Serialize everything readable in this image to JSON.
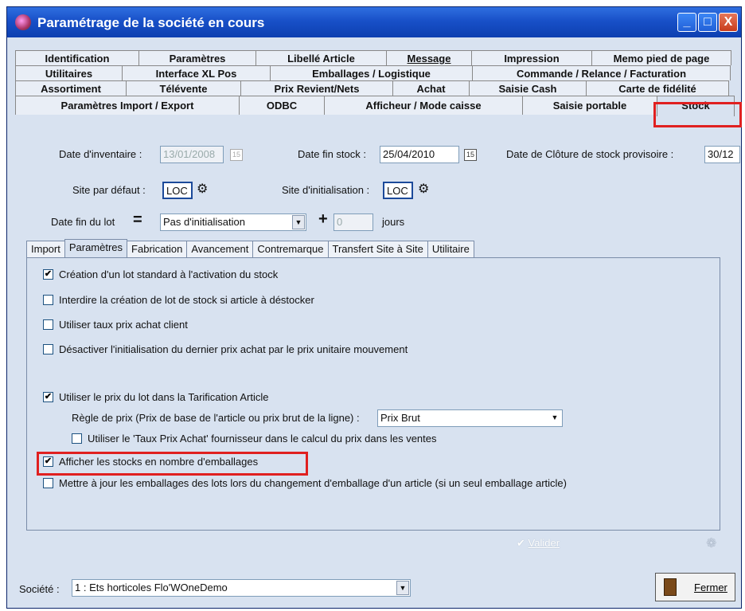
{
  "window": {
    "title": "Paramétrage de la société en cours",
    "controls": {
      "minimize": "_",
      "maximize": "□",
      "close": "X"
    }
  },
  "tabs": {
    "row1": [
      "Identification",
      "Paramètres",
      "Libellé Article",
      "Message",
      "Impression",
      "Memo pied de page"
    ],
    "row2": [
      "Utilitaires",
      "Interface XL Pos",
      "Emballages / Logistique",
      "Commande / Relance / Facturation"
    ],
    "row3": [
      "Assortiment",
      "Télévente",
      "Prix Revient/Nets",
      "Achat",
      "Saisie Cash",
      "Carte de fidélité"
    ],
    "row4": [
      "Paramètres Import / Export",
      "ODBC",
      "Afficheur / Mode caisse",
      "Saisie portable",
      "Stock"
    ]
  },
  "stock": {
    "inventory_date_label": "Date d'inventaire :",
    "inventory_date_value": "13/01/2008",
    "end_date_label": "Date fin stock :",
    "end_date_value": "25/04/2010",
    "closing_label": "Date de Clôture de stock provisoire :",
    "closing_value": "30/12",
    "calendar_glyph": "15",
    "default_site_label": "Site par défaut :",
    "default_site_value": "LOC",
    "init_site_label": "Site d'initialisation :",
    "init_site_value": "LOC",
    "lot_end_label": "Date fin du lot",
    "equals": "=",
    "lot_end_value": "Pas d'initialisation",
    "plus": "+",
    "days_value": "0",
    "days_label": "jours"
  },
  "subtabs": [
    "Import",
    "Paramètres",
    "Fabrication",
    "Avancement",
    "Contremarque",
    "Transfert Site à Site",
    "Utilitaire"
  ],
  "options": {
    "cb1": "Création d'un lot standard à l'activation du stock",
    "cb2": "Interdire la création de lot de stock si article à déstocker",
    "cb3": "Utiliser taux prix achat client",
    "cb4": "Désactiver l'initialisation du dernier prix achat par le prix unitaire mouvement",
    "cb5": "Utiliser le prix du lot dans la Tarification Article",
    "price_rule_label": "Règle de prix (Prix de base de l'article ou prix brut de la ligne) :",
    "price_rule_value": "Prix Brut",
    "cb6": "Utiliser le 'Taux Prix Achat' fournisseur dans le calcul du prix dans les ventes",
    "cb7": "Afficher les stocks en nombre d'emballages",
    "cb8": "Mettre à jour les emballages des lots lors du changement d'emballage d'un article (si un seul emballage article)",
    "check": "✔"
  },
  "valider_label": "Valider",
  "footer": {
    "societe_label": "Société :",
    "societe_value": "1 : Ets horticoles Flo'WOneDemo",
    "close_label": "Fermer"
  }
}
